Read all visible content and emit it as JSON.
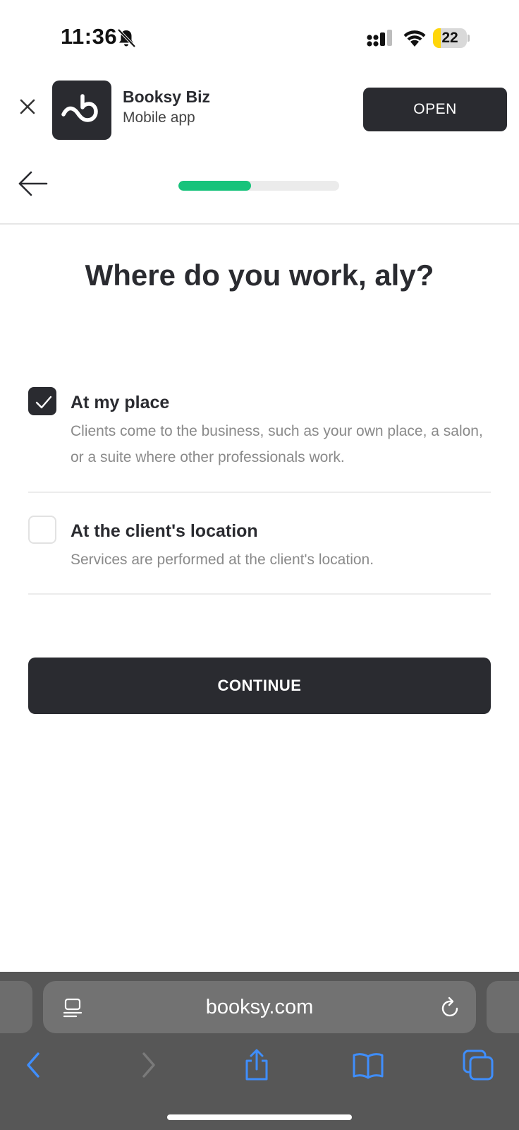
{
  "status_bar": {
    "time": "11:36",
    "battery_percent": "22",
    "battery_level": 0.22,
    "icons": [
      "bell-slash-icon",
      "cellular-signal-icon",
      "wifi-icon",
      "battery-icon"
    ]
  },
  "app_banner": {
    "app_name": "Booksy Biz",
    "app_subtitle": "Mobile app",
    "open_label": "OPEN",
    "icons": [
      "close-icon",
      "booksy-logo-icon"
    ]
  },
  "nav": {
    "back_icon": "arrow-left-icon",
    "progress": 0.45,
    "progress_color": "#17c37b"
  },
  "main": {
    "heading": "Where do you work, aly?",
    "options": [
      {
        "title": "At my place",
        "description": "Clients come to the business, such as your own place, a salon, or a suite where other professionals work.",
        "checked": true
      },
      {
        "title": "At the client's location",
        "description": "Services are performed at the client's location.",
        "checked": false
      }
    ],
    "continue_label": "CONTINUE"
  },
  "browser": {
    "url": "booksy.com",
    "icons": [
      "reader-mode-icon",
      "reload-icon",
      "back-icon",
      "forward-icon",
      "share-icon",
      "bookmarks-icon",
      "tabs-icon"
    ]
  },
  "colors": {
    "primary_dark": "#2a2b30",
    "accent_green": "#17c37b",
    "ios_blue": "#3f8efc",
    "battery_yellow": "#ffd60a"
  }
}
